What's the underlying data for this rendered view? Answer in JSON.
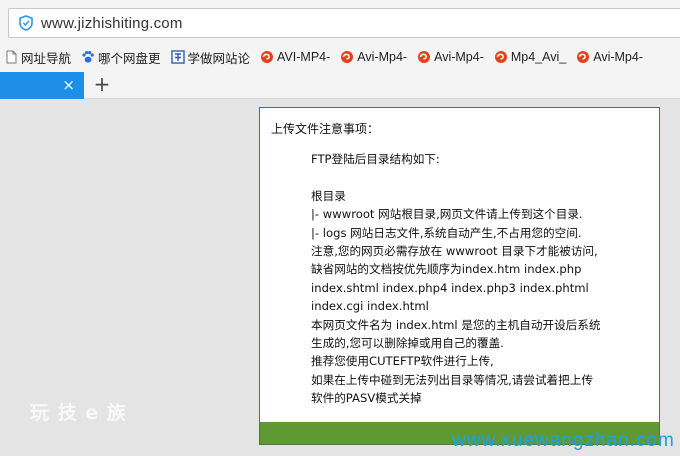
{
  "browser": {
    "url": "www.jizhishiting.com",
    "bookmarks": [
      {
        "label": "网址导航",
        "icon": "page-icon"
      },
      {
        "label": "哪个网盘更",
        "icon": "paw-icon"
      },
      {
        "label": "学做网站论",
        "icon": "bookmark-site-icon"
      },
      {
        "label": "AVI-MP4-",
        "icon": "swirl-icon"
      },
      {
        "label": "Avi-Mp4-",
        "icon": "swirl-icon"
      },
      {
        "label": "Avi-Mp4-",
        "icon": "swirl-icon"
      },
      {
        "label": "Mp4_Avi_",
        "icon": "swirl-icon"
      },
      {
        "label": "Avi-Mp4-",
        "icon": "swirl-icon"
      }
    ],
    "tabs": {
      "close_glyph": "×",
      "add_glyph": "+"
    },
    "accent_color": "#1e8fe8"
  },
  "panel": {
    "title": "上传文件注意事项：",
    "lines": [
      "FTP登陆后目录结构如下:",
      "",
      "根目录",
      "|- wwwroot 网站根目录,网页文件请上传到这个目录.",
      "|- logs 网站日志文件,系统自动产生,不占用您的空间.",
      "注意,您的网页必需存放在 wwwroot 目录下才能被访问,",
      "缺省网站的文档按优先顺序为index.htm index.php",
      "index.shtml index.php4 index.php3 index.phtml",
      "index.cgi index.html",
      "本网页文件名为 index.html 是您的主机自动开设后系统",
      "生成的,您可以删除掉或用自己的覆盖.",
      "推荐您使用CUTEFTP软件进行上传,",
      "如果在上传中碰到无法列出目录等情况,请尝试着把上传",
      "软件的PASV模式关掉"
    ],
    "border_color": "#4c7d36",
    "footer_color": "#5e9934"
  },
  "watermarks": {
    "left": "玩 技 e 族",
    "right": "www.xuewangzhan.com"
  }
}
